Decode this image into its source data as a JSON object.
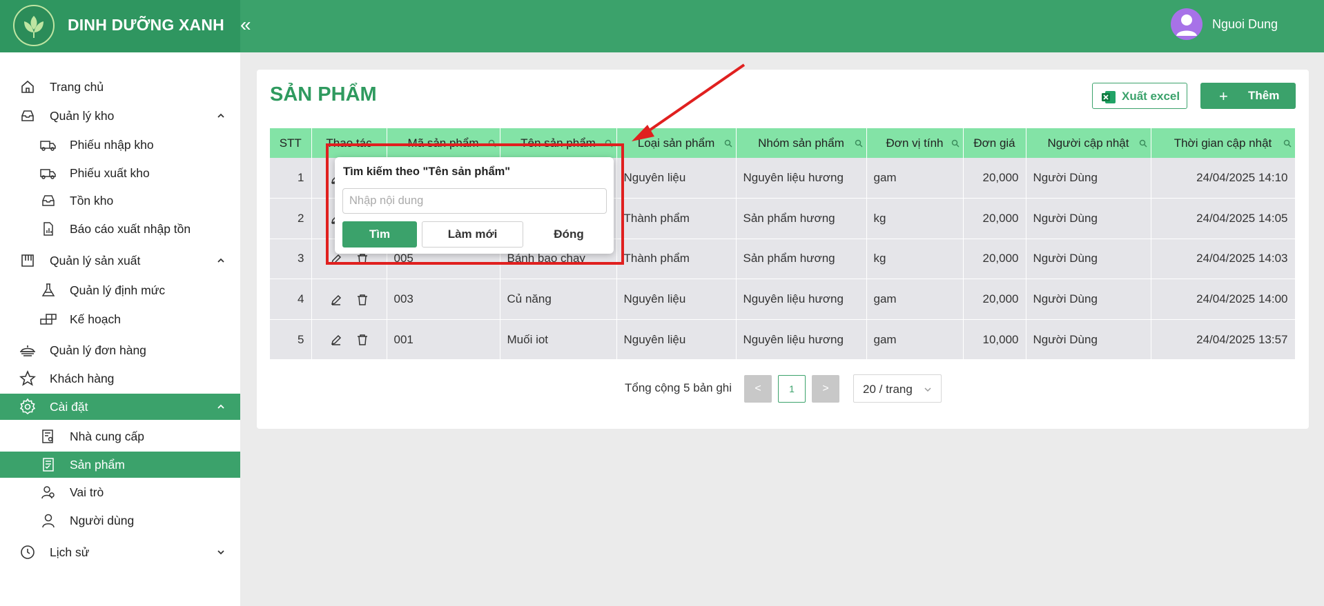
{
  "app": {
    "brand": "DINH DƯỠNG XANH",
    "user": "Nguoi Dung"
  },
  "sidebar": {
    "items": [
      {
        "label": "Trang chủ",
        "icon": "home-icon"
      },
      {
        "label": "Quản lý kho",
        "icon": "inbox-icon",
        "expanded": true
      },
      {
        "label": "Phiếu nhập kho",
        "icon": "truck-in-icon"
      },
      {
        "label": "Phiếu xuất kho",
        "icon": "truck-out-icon"
      },
      {
        "label": "Tồn kho",
        "icon": "inbox-icon"
      },
      {
        "label": "Báo cáo xuất nhập tồn",
        "icon": "report-icon"
      },
      {
        "label": "Quản lý sản xuất",
        "icon": "factory-icon",
        "expanded": true
      },
      {
        "label": "Quản lý định mức",
        "icon": "flask-icon"
      },
      {
        "label": "Kế hoạch",
        "icon": "blocks-icon"
      },
      {
        "label": "Quản lý đơn hàng",
        "icon": "dish-icon"
      },
      {
        "label": "Khách hàng",
        "icon": "star-icon"
      },
      {
        "label": "Cài đặt",
        "icon": "gear-icon",
        "expanded": true,
        "active": true
      },
      {
        "label": "Nhà cung cấp",
        "icon": "supplier-icon"
      },
      {
        "label": "Sản phẩm",
        "icon": "product-icon",
        "active": true
      },
      {
        "label": "Vai trò",
        "icon": "role-icon"
      },
      {
        "label": "Người dùng",
        "icon": "user-icon"
      },
      {
        "label": "Lịch sử",
        "icon": "history-icon",
        "expanded": false
      }
    ]
  },
  "page": {
    "title": "SẢN PHẨM",
    "excel_label": "Xuất excel",
    "add_label": "Thêm"
  },
  "table": {
    "headers": [
      "STT",
      "Thao tác",
      "Mã sản phẩm",
      "Tên sản phẩm",
      "Loại sản phẩm",
      "Nhóm sản phẩm",
      "Đơn vị tính",
      "Đơn giá",
      "Người cập nhật",
      "Thời gian cập nhật"
    ],
    "rows": [
      {
        "stt": "1",
        "code": "",
        "name": "",
        "type": "Nguyên liệu",
        "group": "Nguyên liệu hương",
        "unit": "gam",
        "price": "20,000",
        "updater": "Người Dùng",
        "time": "24/04/2025 14:10"
      },
      {
        "stt": "2",
        "code": "",
        "name": "",
        "type": "Thành phẩm",
        "group": "Sản phẩm hương",
        "unit": "kg",
        "price": "20,000",
        "updater": "Người Dùng",
        "time": "24/04/2025 14:05"
      },
      {
        "stt": "3",
        "code": "005",
        "name": "Bánh bao chay",
        "type": "Thành phẩm",
        "group": "Sản phẩm hương",
        "unit": "kg",
        "price": "20,000",
        "updater": "Người Dùng",
        "time": "24/04/2025 14:03"
      },
      {
        "stt": "4",
        "code": "003",
        "name": "Củ năng",
        "type": "Nguyên liệu",
        "group": "Nguyên liệu hương",
        "unit": "gam",
        "price": "20,000",
        "updater": "Người Dùng",
        "time": "24/04/2025 14:00"
      },
      {
        "stt": "5",
        "code": "001",
        "name": "Muối iot",
        "type": "Nguyên liệu",
        "group": "Nguyên liệu hương",
        "unit": "gam",
        "price": "10,000",
        "updater": "Người Dùng",
        "time": "24/04/2025 13:57"
      }
    ]
  },
  "pagination": {
    "total": "Tổng cộng 5 bản ghi",
    "prev": "<",
    "current": "1",
    "next": ">",
    "page_size": "20 / trang"
  },
  "popup": {
    "title": "Tìm kiếm theo \"Tên sản phẩm\"",
    "placeholder": "Nhập nội dung",
    "search_label": "Tìm",
    "reset_label": "Làm mới",
    "close_label": "Đóng"
  },
  "colors": {
    "primary": "#3ba26b",
    "header_row": "#83e3a6",
    "annotation": "#e0201f"
  }
}
